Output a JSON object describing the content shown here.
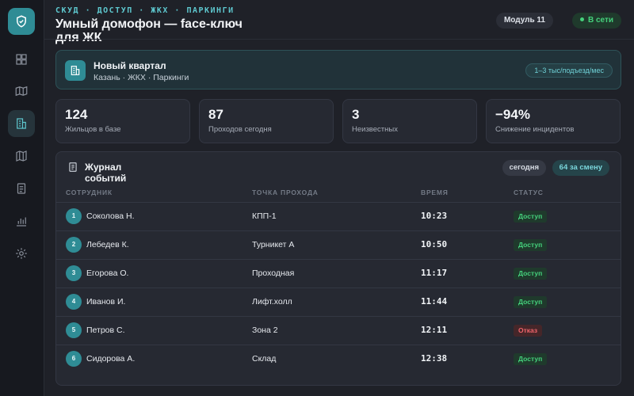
{
  "header": {
    "breadcrumb": "СКУД · ДОСТУП · ЖКХ · ПАРКИНГИ",
    "title": "Умный домофон — face-ключ для ЖК",
    "module": "Модуль 11",
    "status": "В сети",
    "status_color": "#45d17c"
  },
  "sidebar": {
    "items": [
      {
        "icon": "dashboard-icon"
      },
      {
        "icon": "map-icon"
      },
      {
        "icon": "building-icon",
        "active": true
      },
      {
        "icon": "map-fold-icon"
      },
      {
        "icon": "document-icon"
      },
      {
        "icon": "chart-icon"
      },
      {
        "icon": "gear-icon"
      }
    ]
  },
  "project": {
    "name": "Новый квартал",
    "meta": "Казань · ЖКХ · Паркинги",
    "price": "1–3 тыс/подъезд/мес"
  },
  "stats": [
    {
      "value": "124",
      "label": "Жильцов в базе"
    },
    {
      "value": "87",
      "label": "Проходов сегодня"
    },
    {
      "value": "3",
      "label": "Неизвестных"
    },
    {
      "value": "−94%",
      "label": "Снижение инцидентов"
    }
  ],
  "journal": {
    "title": "Журнал событий",
    "filter_today": "сегодня",
    "shift_count": "64 за смену",
    "columns": [
      "СОТРУДНИК",
      "ТОЧКА ПРОХОДА",
      "ВРЕМЯ",
      "СТАТУС"
    ],
    "rows": [
      {
        "num": "1",
        "name": "Соколова Н.",
        "point": "КПП-1",
        "time": "10:23",
        "status": "Доступ",
        "ok": true
      },
      {
        "num": "2",
        "name": "Лебедев К.",
        "point": "Турникет А",
        "time": "10:50",
        "status": "Доступ",
        "ok": true
      },
      {
        "num": "3",
        "name": "Егорова О.",
        "point": "Проходная",
        "time": "11:17",
        "status": "Доступ",
        "ok": true
      },
      {
        "num": "4",
        "name": "Иванов И.",
        "point": "Лифт.холл",
        "time": "11:44",
        "status": "Доступ",
        "ok": true
      },
      {
        "num": "5",
        "name": "Петров С.",
        "point": "Зона 2",
        "time": "12:11",
        "status": "Отказ",
        "ok": false
      },
      {
        "num": "6",
        "name": "Сидорова А.",
        "point": "Склад",
        "time": "12:38",
        "status": "Доступ",
        "ok": true
      }
    ]
  },
  "colors": {
    "accent": "#2f8c95",
    "success": "#45d17c",
    "danger": "#f0646b"
  }
}
